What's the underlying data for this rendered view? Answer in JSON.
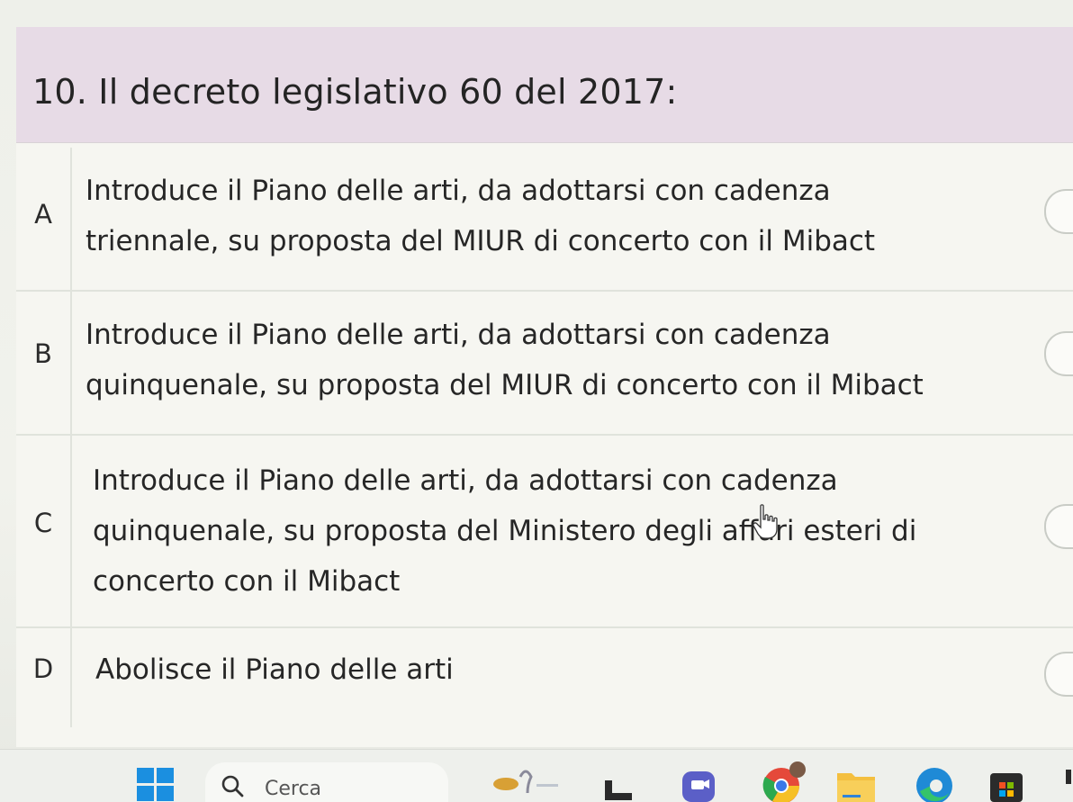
{
  "question": {
    "title": "10. Il decreto legislativo 60 del 2017:"
  },
  "options": [
    {
      "letter": "A",
      "text": "Introduce il Piano delle arti, da adottarsi con cadenza\ntriennale, su proposta del MIUR di concerto con il Mibact"
    },
    {
      "letter": "B",
      "text": "Introduce il Piano delle arti, da adottarsi con cadenza\nquinquenale, su proposta del MIUR di concerto con il Mibact"
    },
    {
      "letter": "C",
      "text": "Introduce il Piano delle arti, da adottarsi con cadenza\nquinquenale, su proposta del Ministero degli affari esteri di\nconcerto con il Mibact"
    },
    {
      "letter": "D",
      "text": "Abolisce il Piano delle arti"
    }
  ],
  "taskbar": {
    "search_label": "Cerca",
    "icons": [
      "windows-start-icon",
      "search-icon",
      "weather-widget-icon",
      "task-view-icon",
      "teams-chat-icon",
      "chrome-icon",
      "file-explorer-icon",
      "edge-icon",
      "store-icon"
    ]
  },
  "colors": {
    "header_bg": "#e7dbe6",
    "option_bg": "#f6f6f1",
    "windows_blue": "#1b8fe0"
  }
}
